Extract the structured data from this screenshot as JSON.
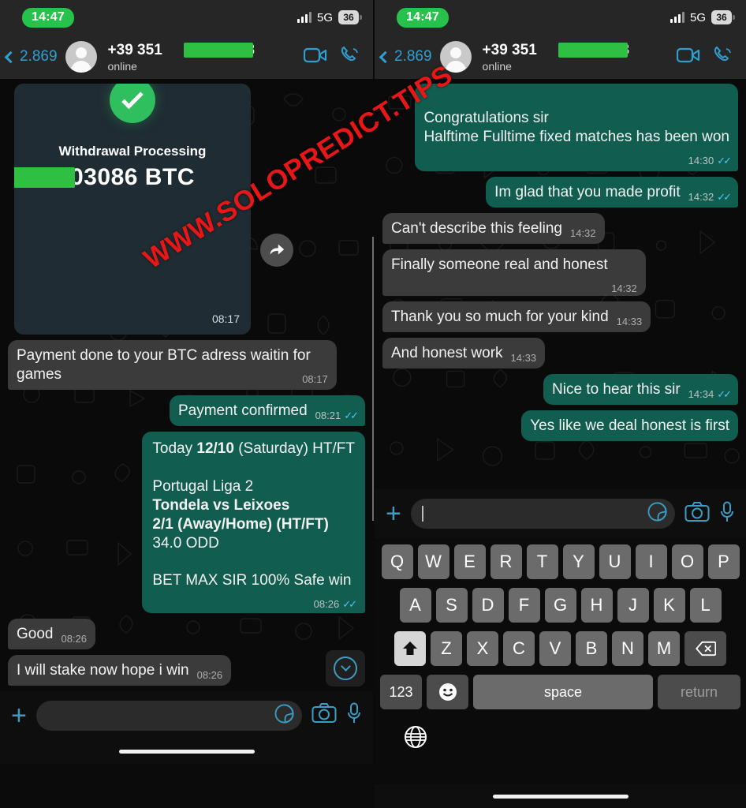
{
  "watermark": "WWW.SOLOPREDICT.TIPS",
  "status_bar": {
    "time": "14:47",
    "network": "5G",
    "battery": "36",
    "signal_icon": "signal-bars-icon"
  },
  "chat_header": {
    "back_icon": "chevron-left-icon",
    "unread_count": "2.869",
    "avatar_icon": "default-contact-avatar",
    "contact_name_prefix": "+39 351",
    "contact_name_suffix": "38",
    "presence": "online",
    "video_call_icon": "video-camera-icon",
    "voice_call_icon": "phone-icon"
  },
  "left_pane": {
    "payment_card": {
      "status_icon": "green-check-circle-icon",
      "title": "Withdrawal Processing",
      "amount": "03086 BTC",
      "time": "08:17"
    },
    "forward_icon": "forward-arrow-icon",
    "scroll_down_icon": "chevron-down-circle-icon",
    "messages": [
      {
        "dir": "in",
        "text": "Payment done to your BTC adress waitin for games",
        "time": "08:17",
        "ticks": ""
      },
      {
        "dir": "out",
        "text": "Payment confirmed",
        "time": "08:21",
        "ticks": "✓✓"
      },
      {
        "dir": "out",
        "text": "",
        "time": "08:26",
        "ticks": "✓✓",
        "rich": [
          {
            "t": "Today ",
            "b": false
          },
          {
            "t": "12/10",
            "b": true
          },
          {
            "t": " (Saturday) HT/FT",
            "b": false
          },
          {
            "t": "\n\n",
            "b": false
          },
          {
            "t": "Portugal Liga 2\n",
            "b": false
          },
          {
            "t": "Tondela vs Leixoes\n",
            "b": true
          },
          {
            "t": "2/1 (Away/Home) (HT/FT)\n",
            "b": true
          },
          {
            "t": "34.0 ODD",
            "b": false
          },
          {
            "t": "\n\n",
            "b": false
          },
          {
            "t": "BET MAX SIR 100% Safe win",
            "b": false
          }
        ]
      },
      {
        "dir": "in",
        "text": "Good",
        "time": "08:26",
        "ticks": ""
      },
      {
        "dir": "in",
        "text": "I will stake now hope i win",
        "time": "08:26",
        "ticks": ""
      }
    ],
    "composer": {
      "placeholder": "",
      "plus_icon": "plus-icon",
      "sticker_icon": "sticker-icon",
      "camera_icon": "camera-icon",
      "mic_icon": "microphone-icon"
    }
  },
  "right_pane": {
    "messages": [
      {
        "dir": "out",
        "text": "Congratulations sir\nHalftime Fulltime fixed matches has been won",
        "time": "14:30",
        "ticks": "✓✓"
      },
      {
        "dir": "out",
        "text": "Im glad that you made profit",
        "time": "14:32",
        "ticks": "✓✓"
      },
      {
        "dir": "in",
        "text": "Can't describe this feeling",
        "time": "14:32",
        "ticks": ""
      },
      {
        "dir": "in",
        "text": "Finally someone real and honest",
        "time": "14:32",
        "ticks": ""
      },
      {
        "dir": "in",
        "text": "Thank you so much for your kind",
        "time": "14:33",
        "ticks": ""
      },
      {
        "dir": "in",
        "text": "And honest work",
        "time": "14:33",
        "ticks": ""
      },
      {
        "dir": "out",
        "text": "Nice to hear this sir",
        "time": "14:34",
        "ticks": "✓✓"
      },
      {
        "dir": "out",
        "text": "Yes like we deal honest is first",
        "time": "",
        "ticks": ""
      }
    ],
    "composer": {
      "placeholder": "",
      "plus_icon": "plus-icon",
      "sticker_icon": "sticker-icon",
      "camera_icon": "camera-icon",
      "mic_icon": "microphone-icon"
    },
    "keyboard": {
      "row1": [
        "Q",
        "W",
        "E",
        "R",
        "T",
        "Y",
        "U",
        "I",
        "O",
        "P"
      ],
      "row2": [
        "A",
        "S",
        "D",
        "F",
        "G",
        "H",
        "J",
        "K",
        "L"
      ],
      "row3": [
        "Z",
        "X",
        "C",
        "V",
        "B",
        "N",
        "M"
      ],
      "shift_icon": "shift-up-arrow-icon",
      "delete_icon": "backspace-icon",
      "numeric_label": "123",
      "emoji_icon": "emoji-smiley-icon",
      "space_label": "space",
      "return_label": "return",
      "globe_icon": "globe-language-icon"
    }
  },
  "colors": {
    "outgoing_bubble": "#115e50",
    "incoming_bubble": "#3b3b3b",
    "accent_blue": "#3a9dc4",
    "status_green": "#27c24c",
    "watermark_red": "#e81717",
    "redaction_green": "#2fbf42"
  }
}
